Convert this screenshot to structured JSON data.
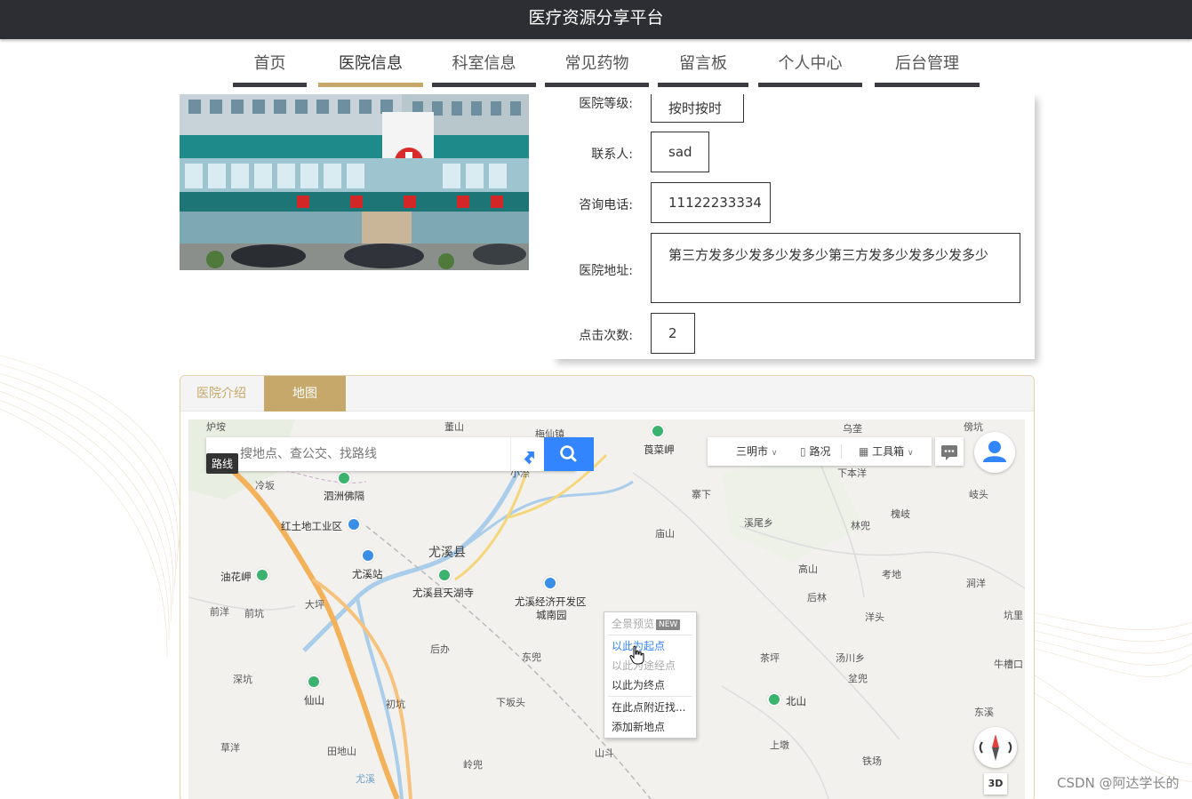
{
  "app": {
    "title": "医疗资源分享平台"
  },
  "nav": {
    "items": [
      "首页",
      "医院信息",
      "科室信息",
      "常见药物",
      "留言板",
      "个人中心",
      "后台管理"
    ],
    "active_index": 1
  },
  "hospital": {
    "fields": [
      {
        "label": "医院等级:",
        "value": "按时按时"
      },
      {
        "label": "联系人:",
        "value": "sad"
      },
      {
        "label": "咨询电话:",
        "value": "11122233334"
      },
      {
        "label": "医院地址:",
        "value": "第三方发多少发多少发多少第三方发多少发多少发多少"
      },
      {
        "label": "点击次数:",
        "value": "2"
      }
    ]
  },
  "tabs": [
    {
      "label": "医院介绍"
    },
    {
      "label": "地图"
    }
  ],
  "map": {
    "search_placeholder": "搜地点、查公交、找路线",
    "route_tip": "路线",
    "city": "三明市",
    "traffic": "路况",
    "toolbox": "工具箱",
    "btn_3d": "3D",
    "context_menu": {
      "panorama": "全景预览",
      "new_badge": "NEW",
      "set_start": "以此为起点",
      "set_via": "以此为途经点",
      "set_end": "以此为终点",
      "search_nearby": "在此点附近找...",
      "add_place": "添加新地点"
    },
    "labels": {
      "county": "尤溪县",
      "l_sizhou": "泗洲佛隔",
      "l_hongtu": "红土地工业区",
      "l_station": "尤溪站",
      "l_tianhu": "尤溪县天湖寺",
      "l_kaifa1": "尤溪经济开发区",
      "l_kaifa2": "城南园",
      "l_youhua": "油花岬",
      "l_caicai": "莨菜岬",
      "l_xianshan": "仙山",
      "l_beishan": "北山",
      "l_xiweixiang": "溪尾乡",
      "l_tangchuan": "汤川乡",
      "l_qianyang": "前洋",
      "l_qiankeng": "前坑",
      "l_daping": "大坪",
      "l_shenkeng": "深坑",
      "l_caoyang": "草洋",
      "l_tiandishan": "田地山",
      "l_xiaokeng": "下坂头",
      "l_dongdou": "东兜",
      "l_lingdou": "岭兜",
      "l_shandou": "山斗",
      "l_chaping": "茶坪",
      "l_houlin": "后林",
      "l_gaoshan": "高山",
      "l_yangtou": "洋头",
      "l_kaodi": "考地",
      "l_linding": "林兜",
      "l_jiayang": "涧洋",
      "l_kengli": "坑里",
      "l_niucaokou": "牛槽口",
      "l_dongxi": "东溪",
      "l_tieyang": "铁场",
      "l_shangtou": "上墩",
      "l_jiaoxia": "寨下",
      "l_xiaben": "下本洋",
      "l_wuyang": "乌垄",
      "l_pangkeng": "傍坑",
      "l_qitou": "岐头",
      "l_yanglang": "槐岐",
      "l_meishan": "梅仙镇",
      "l_dongshan": "董山",
      "l_zhaocun": "小漈",
      "l_lengban": "冷坂",
      "l_miaoshan": "庙山",
      "l_houban": "后办",
      "l_chukeng": "初坑",
      "l_zhenbian": "坌兜",
      "l_yuxi_river": "尤溪",
      "l_guting": "炉垵"
    }
  },
  "watermark": "CSDN @阿达学长的"
}
